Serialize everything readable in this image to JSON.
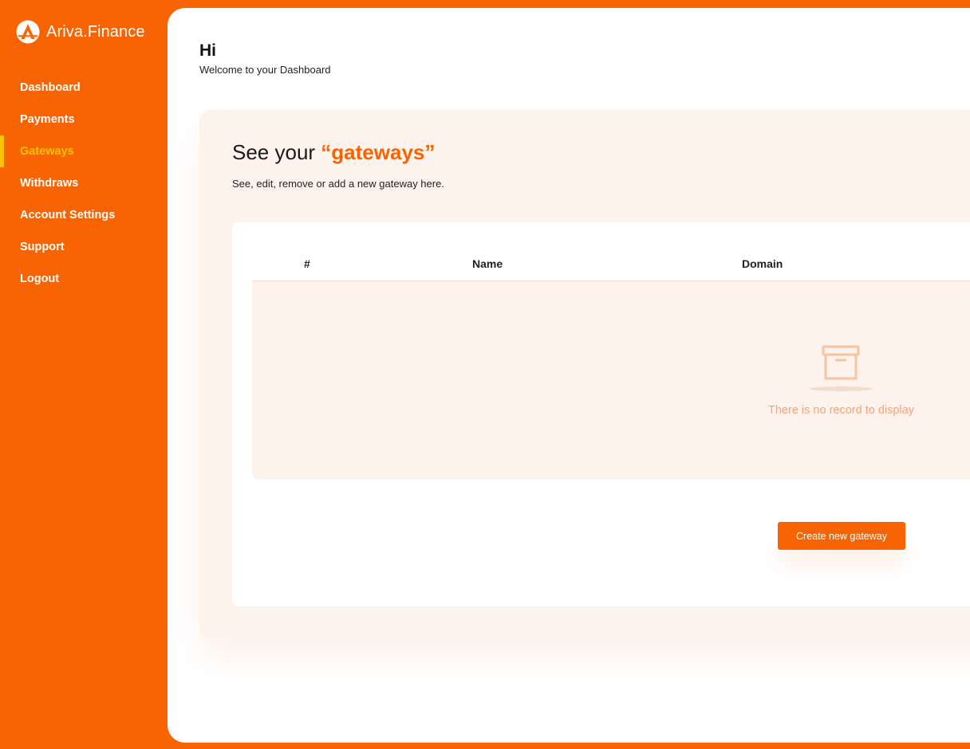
{
  "app": {
    "name": "Ariva.Finance"
  },
  "sidebar": {
    "items": [
      {
        "label": "Dashboard"
      },
      {
        "label": "Payments"
      },
      {
        "label": "Gateways",
        "active": true
      },
      {
        "label": "Withdraws"
      },
      {
        "label": "Account Settings"
      },
      {
        "label": "Support"
      },
      {
        "label": "Logout"
      }
    ]
  },
  "header": {
    "greeting": "Hi",
    "subtitle": "Welcome to your Dashboard"
  },
  "card": {
    "title_prefix": "See your ",
    "title_accent": "“gateways”",
    "subtitle": "See, edit, remove or add a new gateway here."
  },
  "table": {
    "columns": [
      "#",
      "Name",
      "Domain"
    ],
    "empty_message": "There is no record to display"
  },
  "actions": {
    "create_label": "Create new gateway"
  },
  "colors": {
    "brand": "#f86402",
    "active_nav": "#fdc300",
    "card_bg": "#fef3ec",
    "empty_text": "#f7a47a"
  },
  "icons": {
    "logo": "ariva-logo-icon",
    "empty": "archive-box-icon"
  }
}
